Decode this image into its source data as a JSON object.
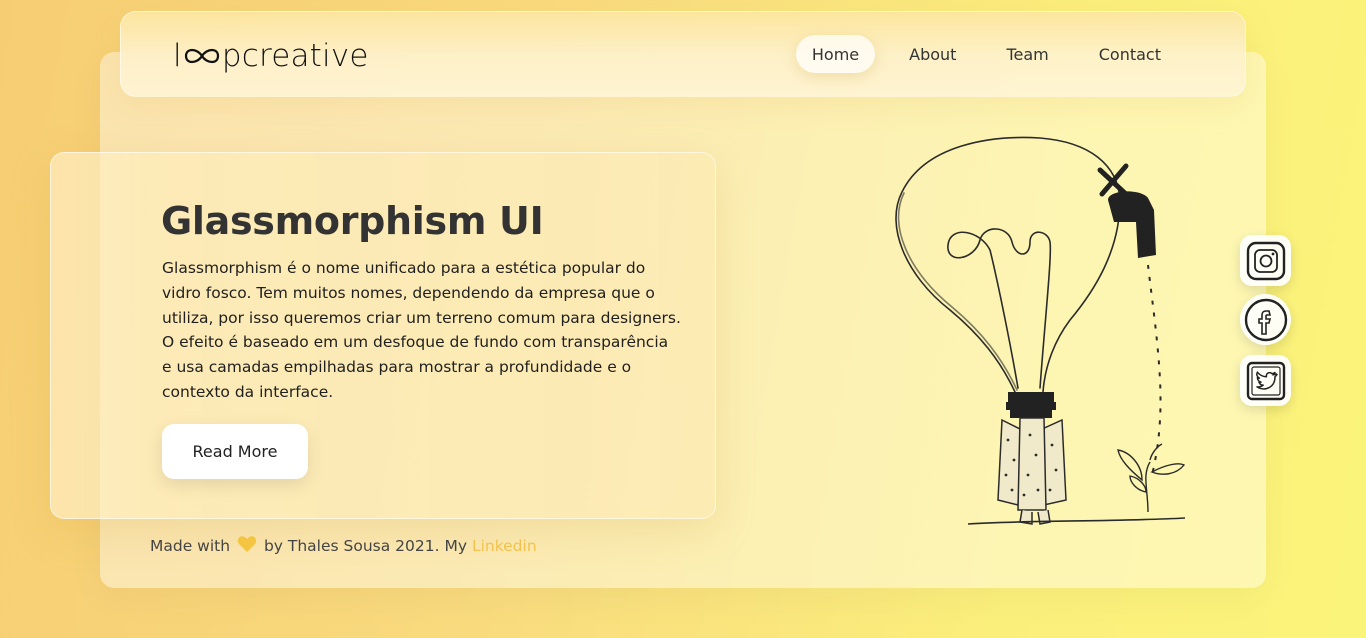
{
  "brand": {
    "logo_text_pre": "l",
    "logo_text_post": "pcreative"
  },
  "nav": {
    "items": [
      {
        "label": "Home",
        "active": true
      },
      {
        "label": "About",
        "active": false
      },
      {
        "label": "Team",
        "active": false
      },
      {
        "label": "Contact",
        "active": false
      }
    ]
  },
  "hero": {
    "title": "Glassmorphism UI",
    "description": "Glassmorphism é o nome unificado para a estética popular do vidro fosco. Tem muitos nomes, dependendo da empresa que o utiliza, por isso queremos criar um terreno comum para designers. O efeito é baseado em um desfoque de fundo com transparência e usa camadas empilhadas para mostrar a profundidade e o contexto da interface.",
    "button_label": "Read More"
  },
  "footer": {
    "prefix": "Made with",
    "suffix": "by Thales Sousa 2021. My",
    "link_label": "Linkedin"
  },
  "social": [
    "instagram-icon",
    "facebook-icon",
    "twitter-icon"
  ],
  "colors": {
    "accent_link": "#f2c14e",
    "background_start": "#f7cd73",
    "background_end": "#fbf47a",
    "heart": "#f5c542"
  }
}
